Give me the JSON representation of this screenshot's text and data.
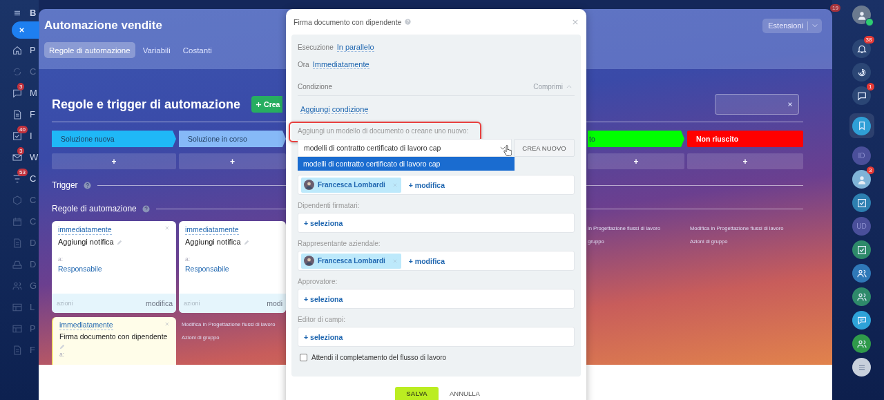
{
  "nav": {
    "title": "B",
    "items": [
      {
        "label": "P",
        "kind": "home",
        "dimmed": false
      },
      {
        "label": "C",
        "kind": "sync",
        "dimmed": true
      },
      {
        "label": "M",
        "kind": "chat",
        "badge": "3",
        "dimmed": false
      },
      {
        "label": "F",
        "kind": "doc",
        "dimmed": false
      },
      {
        "label": "I",
        "kind": "check",
        "badge": "40",
        "dimmed": false
      },
      {
        "label": "W",
        "kind": "mail",
        "badge": "3",
        "dimmed": false
      },
      {
        "label": "C",
        "kind": "filter",
        "badge": "53",
        "dimmed": false
      },
      {
        "label": "C",
        "kind": "hexagon",
        "dimmed": true
      },
      {
        "label": "C",
        "kind": "calendar",
        "dimmed": true
      },
      {
        "label": "D",
        "kind": "doc",
        "dimmed": true
      },
      {
        "label": "D",
        "kind": "drive",
        "dimmed": true
      },
      {
        "label": "G",
        "kind": "group",
        "dimmed": true
      },
      {
        "label": "L",
        "kind": "board",
        "dimmed": true
      },
      {
        "label": "P",
        "kind": "board",
        "dimmed": true
      },
      {
        "label": "F",
        "kind": "doc",
        "dimmed": true
      }
    ]
  },
  "top_badge": "19",
  "panel": {
    "title": "Automazione vendite",
    "tabs": [
      {
        "label": "Regole di automazione",
        "selected": true
      },
      {
        "label": "Variabili",
        "selected": false
      },
      {
        "label": "Costanti",
        "selected": false
      }
    ],
    "extensions_button": "Estensioni",
    "heading": "Regole e trigger di automazione",
    "create_button": "Crea",
    "stages": {
      "left": [
        {
          "label": "Soluzione nuova",
          "color": "#1fb8f7",
          "add": "+"
        },
        {
          "label": "Soluzione in corso",
          "color": "#86b9f7",
          "add": "+"
        }
      ],
      "right": [
        {
          "label": "to",
          "color": "#00ff00",
          "add": "+"
        },
        {
          "label": "Non riuscito",
          "color": "#ff0000",
          "add": "+"
        }
      ]
    },
    "trigger_label": "Trigger",
    "rules_label": "Regole di automazione",
    "rule_rows": [
      {
        "left": [
          {
            "kind": "card",
            "time": "immediatamente",
            "action": "Aggiungi notifica",
            "to_label": "a:",
            "recipient": "Responsabile",
            "footer_left": "azioni",
            "footer_right": "modifica",
            "closable": true
          },
          {
            "kind": "card",
            "time": "immediatamente",
            "action": "Aggiungi notifica",
            "to_label": "a:",
            "recipient": "Responsabile",
            "footer_left": "azioni",
            "footer_right": "modi",
            "closable": false
          }
        ],
        "right": [
          {
            "kind": "links",
            "links": [
              "in Progettazione flussi di lavoro",
              "gruppo"
            ]
          },
          {
            "kind": "links",
            "links": [
              "Modifica in Progettazione flussi di lavoro",
              "Azioni di gruppo"
            ]
          }
        ]
      },
      {
        "left": [
          {
            "kind": "draft",
            "time": "immediatamente",
            "action": "Firma documento con dipendente",
            "to_label": "a:",
            "closable": true
          },
          {
            "kind": "links",
            "links": [
              "Modifica in Progettazione flussi di lavoro",
              "Azioni di gruppo"
            ]
          }
        ],
        "right": []
      }
    ]
  },
  "dialog": {
    "title": "Firma documento con dipendente",
    "rows": [
      {
        "label": "Esecuzione",
        "value": "In parallelo"
      },
      {
        "label": "Ora",
        "value": "Immediatamente"
      }
    ],
    "condition": {
      "label": "Condizione",
      "toggle": "Comprimi",
      "expanded": true,
      "add_link": "Aggiungi condizione"
    },
    "template": {
      "label": "Aggiungi un modello di documento o creane uno nuovo:",
      "highlighted": true,
      "value": "modelli di contratto certificato di lavoro cap",
      "create_button": "CREA NUOVO",
      "options": [
        {
          "label": "modelli di contratto certificato di lavoro cap",
          "selected": true
        }
      ]
    },
    "fields": [
      {
        "users": [
          "Francesca Lombardi"
        ],
        "action": "+ modifica"
      },
      {
        "label": "Dipendenti firmatari:",
        "action": "+ seleziona"
      },
      {
        "label": "Rappresentante aziendale:",
        "users": [
          "Francesca Lombardi"
        ],
        "action": "+ modifica"
      },
      {
        "label": "Approvatore:",
        "action": "+ seleziona"
      },
      {
        "label": "Editor di campi:",
        "action": "+ seleziona"
      }
    ],
    "wait_checkbox": {
      "label": "Attendi il completamento del flusso di lavoro",
      "checked": false
    },
    "buttons": [
      {
        "label": "SALVA",
        "kind": "primary"
      },
      {
        "label": "ANNULLA",
        "kind": "link"
      }
    ]
  },
  "right_bar": [
    {
      "kind": "avatar",
      "color": "#6b7a8f",
      "online": true,
      "selected": false
    },
    {
      "kind": "bell",
      "color": "#2b4675",
      "badge": "38",
      "selected": false
    },
    {
      "kind": "spiral",
      "color": "#2b4675",
      "selected": false
    },
    {
      "kind": "chat",
      "color": "#2b4675",
      "badge": "1",
      "selected": false
    },
    {
      "kind": "bookmark",
      "color": "#2f9fd6",
      "selected": true
    },
    {
      "kind": "initials",
      "label": "ID",
      "color": "#4a4f9a",
      "selected": false
    },
    {
      "kind": "avatar",
      "color": "#7fb3d8",
      "badge": "3",
      "online": false,
      "selected": false
    },
    {
      "kind": "check",
      "color": "#2d7fb0",
      "selected": false
    },
    {
      "kind": "initials",
      "label": "UD",
      "color": "#4a4f9a",
      "selected": false
    },
    {
      "kind": "check",
      "color": "#2e8a6a",
      "selected": false
    },
    {
      "kind": "group",
      "color": "#2f78b8",
      "selected": false
    },
    {
      "kind": "group",
      "color": "#2e8a6a",
      "selected": false
    },
    {
      "kind": "message",
      "color": "#2ea2d8",
      "selected": false
    },
    {
      "kind": "group",
      "color": "#2f9a4a",
      "selected": false
    },
    {
      "kind": "menu",
      "color": "#c8d0dc",
      "selected": false
    }
  ]
}
